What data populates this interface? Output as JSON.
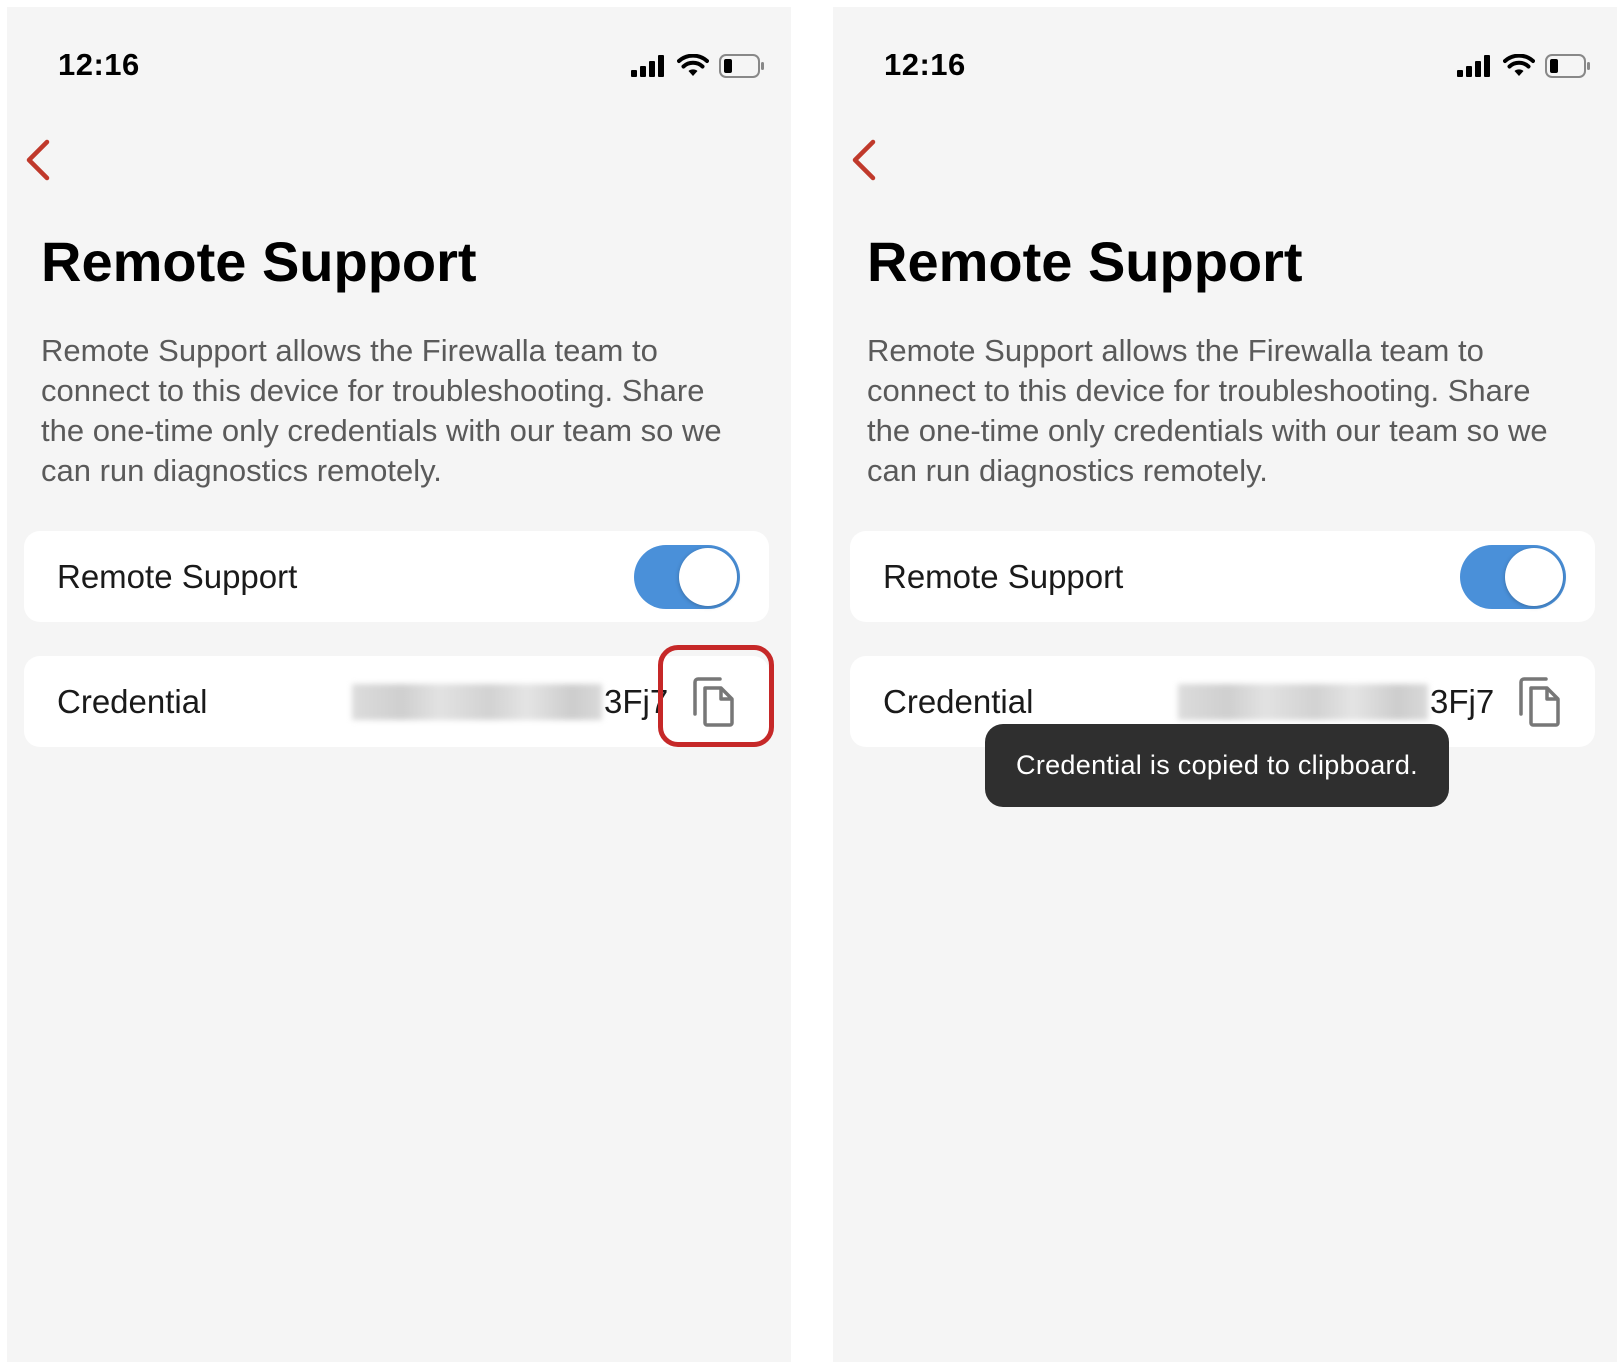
{
  "screens": [
    {
      "status_bar": {
        "time": "12:16"
      },
      "page": {
        "title": "Remote Support",
        "description": "Remote Support allows the Firewalla team to connect to this device for troubleshooting. Share the one-time only credentials with our team so we can run diagnostics remotely."
      },
      "remote_support_row": {
        "label": "Remote Support",
        "enabled": true
      },
      "credential_row": {
        "label": "Credential",
        "visible_suffix": "3Fj7"
      },
      "copy_highlighted": true,
      "toast": null
    },
    {
      "status_bar": {
        "time": "12:16"
      },
      "page": {
        "title": "Remote Support",
        "description": "Remote Support allows the Firewalla team to connect to this device for troubleshooting. Share the one-time only credentials with our team so we can run diagnostics remotely."
      },
      "remote_support_row": {
        "label": "Remote Support",
        "enabled": true
      },
      "credential_row": {
        "label": "Credential",
        "visible_suffix": "3Fj7"
      },
      "copy_highlighted": false,
      "toast": "Credential is copied to clipboard."
    }
  ],
  "icons": {
    "signal": "cellular-signal-icon",
    "wifi": "wifi-icon",
    "battery": "battery-icon",
    "back": "chevron-left-icon",
    "copy": "copy-icon"
  },
  "colors": {
    "accent_red": "#c0392b",
    "toggle_on": "#4a90d9",
    "highlight_box": "#c62828",
    "toast_bg": "#2f2f2f",
    "screen_bg": "#f5f5f5"
  }
}
